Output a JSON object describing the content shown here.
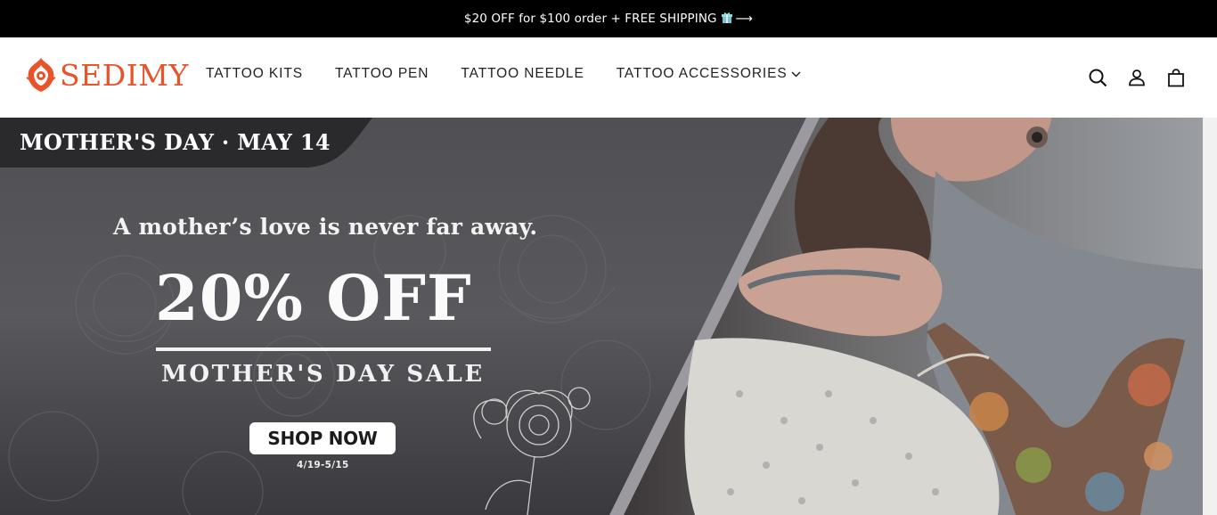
{
  "announcement": {
    "text": "$20 OFF for $100 order + FREE SHIPPING",
    "arrow": "⟶",
    "gift_icon": "gift-icon"
  },
  "header": {
    "logo_text": "SEDIMY",
    "brand_color": "#e8542a",
    "nav": [
      {
        "label": "TATTOO KITS"
      },
      {
        "label": "TATTOO PEN"
      },
      {
        "label": "TATTOO NEEDLE"
      },
      {
        "label": "TATTOO ACCESSORIES",
        "has_dropdown": true
      }
    ],
    "icons": [
      "search-icon",
      "account-icon",
      "cart-icon"
    ]
  },
  "hero": {
    "date_tag": "MOTHER'S DAY · MAY 14",
    "tagline": "A mother’s love is never far away.",
    "headline": "20% OFF",
    "subheadline": "MOTHER'S DAY SALE",
    "cta": "SHOP NOW",
    "dates": "4/19-5/15"
  }
}
